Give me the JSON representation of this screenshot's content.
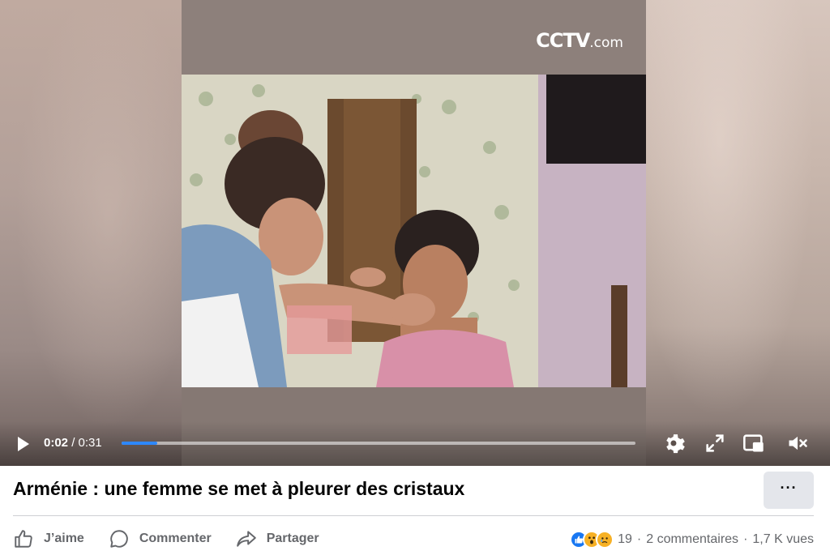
{
  "video": {
    "watermark": "CCTV",
    "watermark_suffix": ".com",
    "current_time": "0:02",
    "time_separator": " / ",
    "duration": "0:31",
    "progress_fraction": 0.07,
    "accent_color": "#2d88ff",
    "icons": [
      "play-icon",
      "settings-gear-icon",
      "fullscreen-icon",
      "picture-in-picture-icon",
      "muted-volume-icon"
    ]
  },
  "post": {
    "title": "Arménie : une femme se met à pleurer des cristaux",
    "more_label": "···",
    "actions": {
      "like": "J’aime",
      "comment": "Commenter",
      "share": "Partager"
    },
    "stats": {
      "reactions": [
        "like",
        "wow",
        "sad"
      ],
      "reaction_count": "19",
      "comments": "2 commentaires",
      "separator": "·",
      "views": "1,7 K vues"
    }
  }
}
